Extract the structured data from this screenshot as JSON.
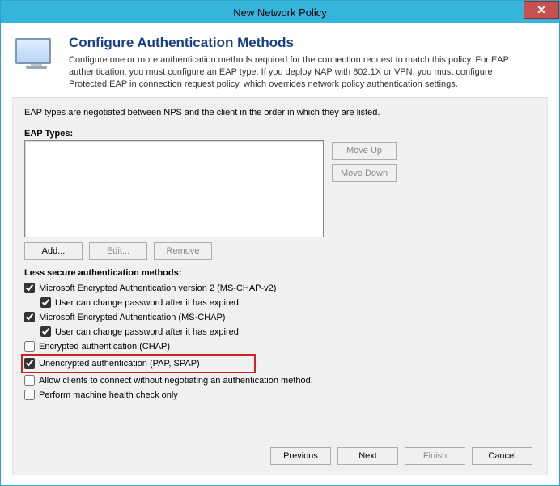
{
  "titlebar": {
    "title": "New Network Policy"
  },
  "header": {
    "title": "Configure Authentication Methods",
    "desc": "Configure one or more authentication methods required for the connection request to match this policy. For EAP authentication, you must configure an EAP type. If you deploy NAP with 802.1X or VPN, you must configure Protected EAP in connection request policy, which overrides network policy authentication settings."
  },
  "panel": {
    "negotiate_text": "EAP types are negotiated between NPS and the client in the order in which they are listed.",
    "eap_types_label": "EAP Types:",
    "move_up": "Move Up",
    "move_down": "Move Down",
    "add": "Add...",
    "edit": "Edit...",
    "remove": "Remove",
    "less_secure_label": "Less secure authentication methods:",
    "cb": {
      "mschapv2": "Microsoft Encrypted Authentication version 2 (MS-CHAP-v2)",
      "mschapv2_expired": "User can change password after it has expired",
      "mschap": "Microsoft Encrypted Authentication (MS-CHAP)",
      "mschap_expired": "User can change password after it has expired",
      "chap": "Encrypted authentication (CHAP)",
      "pap": "Unencrypted authentication (PAP, SPAP)",
      "allow_no_auth": "Allow clients to connect without negotiating an authentication method.",
      "machine_health": "Perform machine health check only"
    }
  },
  "footer": {
    "previous": "Previous",
    "next": "Next",
    "finish": "Finish",
    "cancel": "Cancel"
  }
}
